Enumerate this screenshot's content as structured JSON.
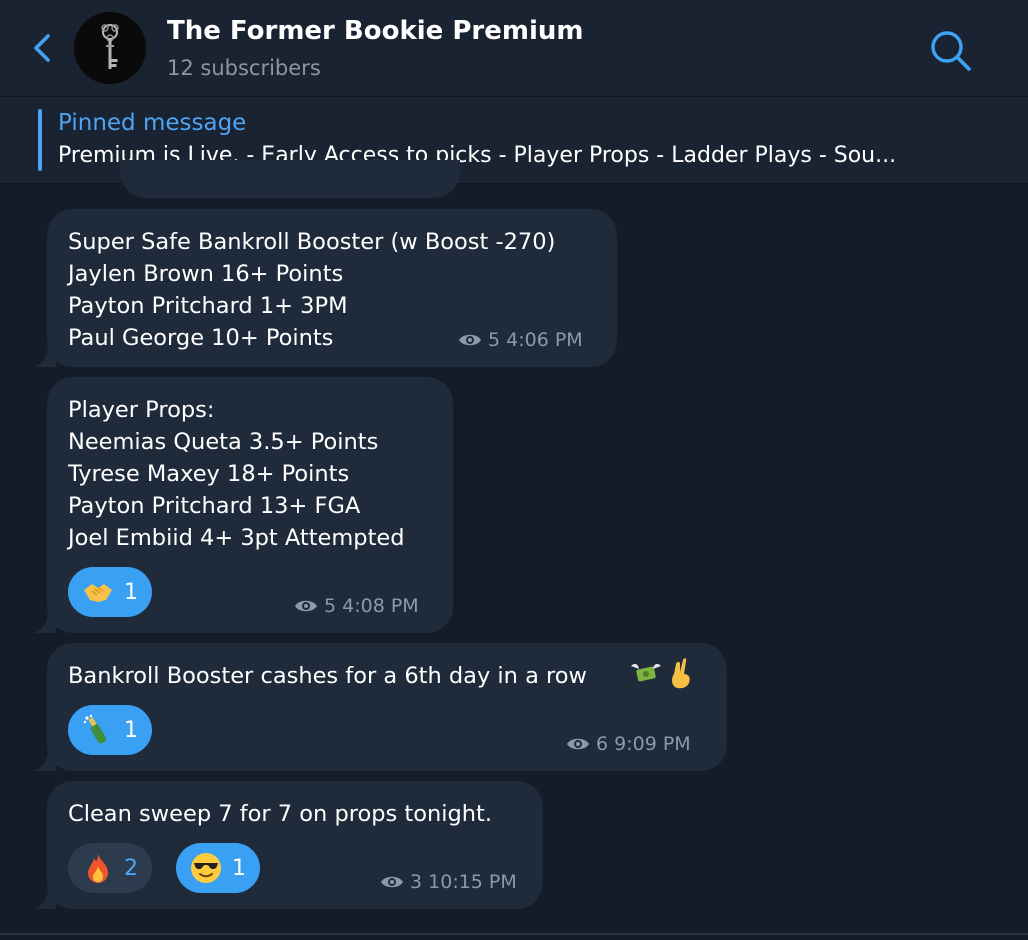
{
  "header": {
    "title": "The Former Bookie Premium",
    "subtitle": "12 subscribers",
    "back_icon": "chevron-left-icon",
    "search_icon": "search-icon",
    "accent": "#3ea2f5"
  },
  "pinned": {
    "title": "Pinned message",
    "text": "Premium is Live.  - Early Access to picks  - Player Props  - Ladder Plays  - Sou..."
  },
  "messages": [
    {
      "lines": [
        "Super Safe Bankroll Booster (w Boost -270)",
        "Jaylen Brown 16+ Points",
        "Payton Pritchard 1+ 3PM",
        "Paul George 10+ Points"
      ],
      "views": "5",
      "time": "4:06 PM"
    },
    {
      "lines": [
        "Player Props:",
        "Neemias Queta 3.5+ Points",
        "Tyrese Maxey 18+ Points",
        "Payton Pritchard 13+ FGA",
        "Joel Embiid 4+ 3pt Attempted"
      ],
      "reactions": [
        {
          "emoji": "handshake-icon",
          "count": "1"
        }
      ],
      "views": "5",
      "time": "4:08 PM"
    },
    {
      "text": "Bankroll Booster cashes for a 6th day in a row",
      "emojis": [
        "money-with-wings-icon",
        "crossed-fingers-icon"
      ],
      "reactions": [
        {
          "emoji": "champagne-icon",
          "count": "1"
        }
      ],
      "views": "6",
      "time": "9:09 PM"
    },
    {
      "text": "Clean sweep 7 for 7 on props tonight.",
      "reactions": [
        {
          "emoji": "fire-icon",
          "count": "2"
        },
        {
          "emoji": "cool-face-icon",
          "count": "1"
        }
      ],
      "views": "3",
      "time": "10:15 PM"
    }
  ],
  "colors": {
    "background": "#141c27",
    "bubble": "#1f2a3a",
    "reaction_active": "#3aa0f3",
    "reaction_inactive": "#2d3b4f",
    "meta": "#8d99a8"
  }
}
